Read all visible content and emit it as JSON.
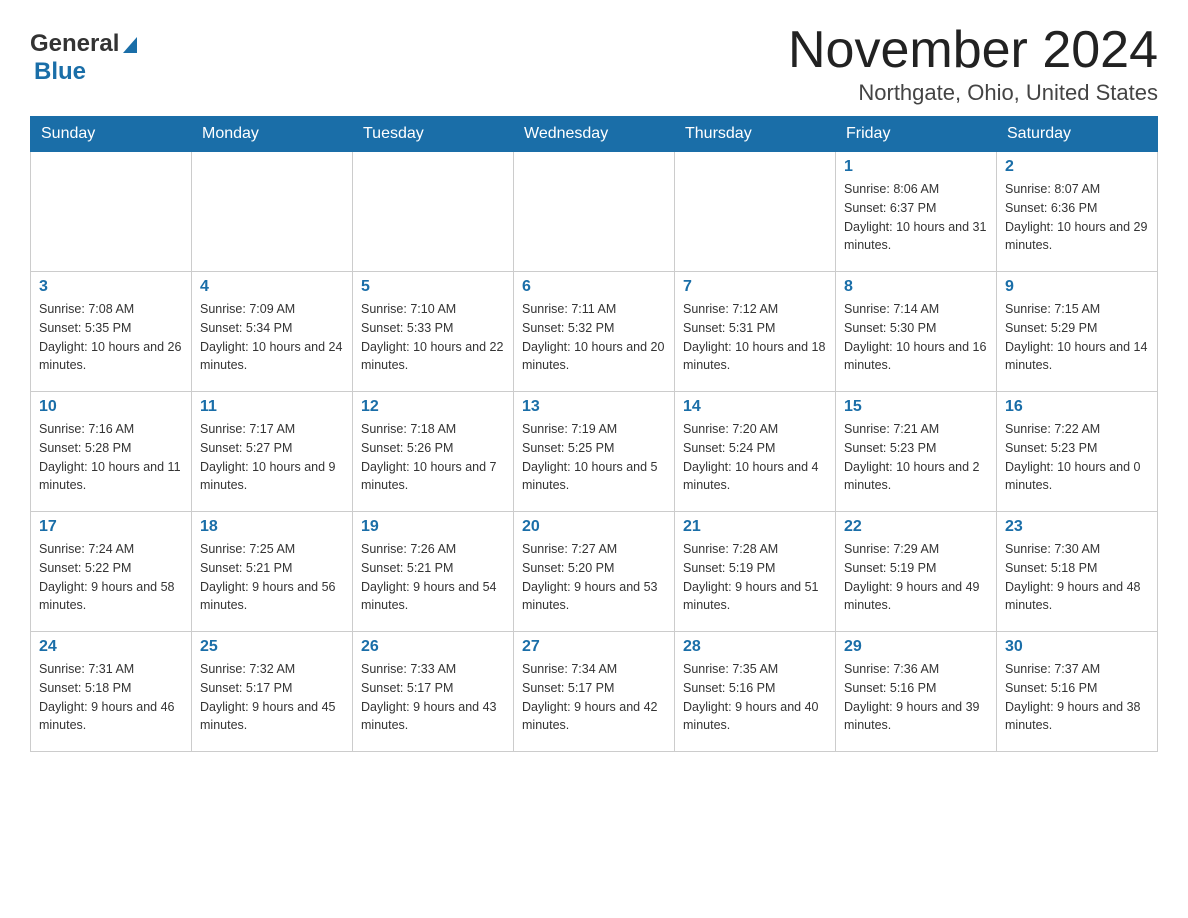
{
  "header": {
    "logo_general": "General",
    "logo_blue": "Blue",
    "title": "November 2024",
    "subtitle": "Northgate, Ohio, United States"
  },
  "days_of_week": [
    "Sunday",
    "Monday",
    "Tuesday",
    "Wednesday",
    "Thursday",
    "Friday",
    "Saturday"
  ],
  "weeks": [
    [
      {
        "day": "",
        "info": ""
      },
      {
        "day": "",
        "info": ""
      },
      {
        "day": "",
        "info": ""
      },
      {
        "day": "",
        "info": ""
      },
      {
        "day": "",
        "info": ""
      },
      {
        "day": "1",
        "info": "Sunrise: 8:06 AM\nSunset: 6:37 PM\nDaylight: 10 hours and 31 minutes."
      },
      {
        "day": "2",
        "info": "Sunrise: 8:07 AM\nSunset: 6:36 PM\nDaylight: 10 hours and 29 minutes."
      }
    ],
    [
      {
        "day": "3",
        "info": "Sunrise: 7:08 AM\nSunset: 5:35 PM\nDaylight: 10 hours and 26 minutes."
      },
      {
        "day": "4",
        "info": "Sunrise: 7:09 AM\nSunset: 5:34 PM\nDaylight: 10 hours and 24 minutes."
      },
      {
        "day": "5",
        "info": "Sunrise: 7:10 AM\nSunset: 5:33 PM\nDaylight: 10 hours and 22 minutes."
      },
      {
        "day": "6",
        "info": "Sunrise: 7:11 AM\nSunset: 5:32 PM\nDaylight: 10 hours and 20 minutes."
      },
      {
        "day": "7",
        "info": "Sunrise: 7:12 AM\nSunset: 5:31 PM\nDaylight: 10 hours and 18 minutes."
      },
      {
        "day": "8",
        "info": "Sunrise: 7:14 AM\nSunset: 5:30 PM\nDaylight: 10 hours and 16 minutes."
      },
      {
        "day": "9",
        "info": "Sunrise: 7:15 AM\nSunset: 5:29 PM\nDaylight: 10 hours and 14 minutes."
      }
    ],
    [
      {
        "day": "10",
        "info": "Sunrise: 7:16 AM\nSunset: 5:28 PM\nDaylight: 10 hours and 11 minutes."
      },
      {
        "day": "11",
        "info": "Sunrise: 7:17 AM\nSunset: 5:27 PM\nDaylight: 10 hours and 9 minutes."
      },
      {
        "day": "12",
        "info": "Sunrise: 7:18 AM\nSunset: 5:26 PM\nDaylight: 10 hours and 7 minutes."
      },
      {
        "day": "13",
        "info": "Sunrise: 7:19 AM\nSunset: 5:25 PM\nDaylight: 10 hours and 5 minutes."
      },
      {
        "day": "14",
        "info": "Sunrise: 7:20 AM\nSunset: 5:24 PM\nDaylight: 10 hours and 4 minutes."
      },
      {
        "day": "15",
        "info": "Sunrise: 7:21 AM\nSunset: 5:23 PM\nDaylight: 10 hours and 2 minutes."
      },
      {
        "day": "16",
        "info": "Sunrise: 7:22 AM\nSunset: 5:23 PM\nDaylight: 10 hours and 0 minutes."
      }
    ],
    [
      {
        "day": "17",
        "info": "Sunrise: 7:24 AM\nSunset: 5:22 PM\nDaylight: 9 hours and 58 minutes."
      },
      {
        "day": "18",
        "info": "Sunrise: 7:25 AM\nSunset: 5:21 PM\nDaylight: 9 hours and 56 minutes."
      },
      {
        "day": "19",
        "info": "Sunrise: 7:26 AM\nSunset: 5:21 PM\nDaylight: 9 hours and 54 minutes."
      },
      {
        "day": "20",
        "info": "Sunrise: 7:27 AM\nSunset: 5:20 PM\nDaylight: 9 hours and 53 minutes."
      },
      {
        "day": "21",
        "info": "Sunrise: 7:28 AM\nSunset: 5:19 PM\nDaylight: 9 hours and 51 minutes."
      },
      {
        "day": "22",
        "info": "Sunrise: 7:29 AM\nSunset: 5:19 PM\nDaylight: 9 hours and 49 minutes."
      },
      {
        "day": "23",
        "info": "Sunrise: 7:30 AM\nSunset: 5:18 PM\nDaylight: 9 hours and 48 minutes."
      }
    ],
    [
      {
        "day": "24",
        "info": "Sunrise: 7:31 AM\nSunset: 5:18 PM\nDaylight: 9 hours and 46 minutes."
      },
      {
        "day": "25",
        "info": "Sunrise: 7:32 AM\nSunset: 5:17 PM\nDaylight: 9 hours and 45 minutes."
      },
      {
        "day": "26",
        "info": "Sunrise: 7:33 AM\nSunset: 5:17 PM\nDaylight: 9 hours and 43 minutes."
      },
      {
        "day": "27",
        "info": "Sunrise: 7:34 AM\nSunset: 5:17 PM\nDaylight: 9 hours and 42 minutes."
      },
      {
        "day": "28",
        "info": "Sunrise: 7:35 AM\nSunset: 5:16 PM\nDaylight: 9 hours and 40 minutes."
      },
      {
        "day": "29",
        "info": "Sunrise: 7:36 AM\nSunset: 5:16 PM\nDaylight: 9 hours and 39 minutes."
      },
      {
        "day": "30",
        "info": "Sunrise: 7:37 AM\nSunset: 5:16 PM\nDaylight: 9 hours and 38 minutes."
      }
    ]
  ]
}
